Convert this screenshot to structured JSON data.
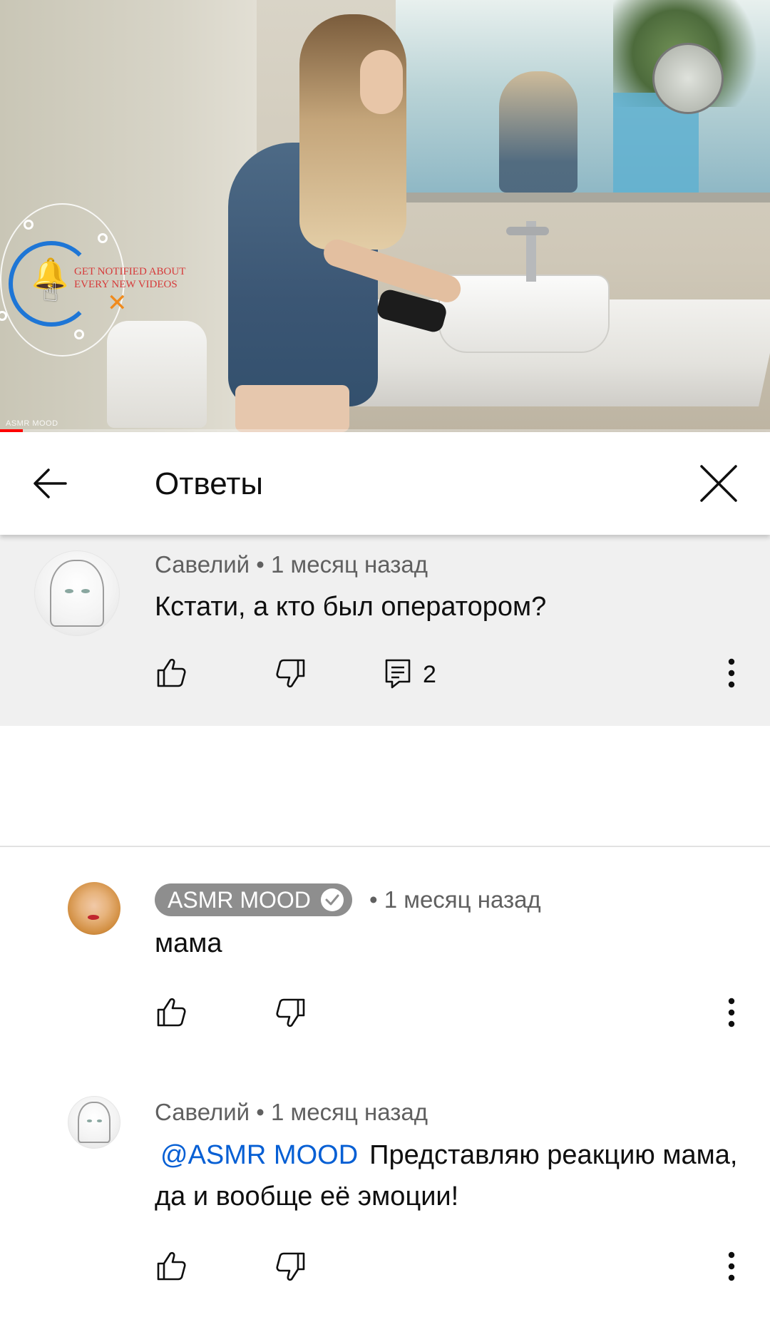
{
  "video": {
    "overlay_text": "GET NOTIFIED ABOUT EVERY NEW VIDEOS",
    "watermark": "ASMR MOOD",
    "progress": 0.03
  },
  "header": {
    "title": "Ответы"
  },
  "parent_comment": {
    "author": "Савелий",
    "time": "1 месяц назад",
    "text": "Кстати, а кто был оператором?",
    "reply_count": "2"
  },
  "replies": [
    {
      "author": "ASMR MOOD",
      "author_verified": true,
      "time": "1 месяц назад",
      "text": "мама"
    },
    {
      "author": "Савелий",
      "time": "1 месяц назад",
      "mention": "@ASMR MOOD",
      "text": "Представляю реакцию мама, да и вообще её эмоции!"
    }
  ],
  "separator": "•",
  "colors": {
    "mention": "#065fd4",
    "progress": "#ff0000",
    "meta": "#606060",
    "parent_bg": "#f0f0f0"
  },
  "icons": [
    "back-arrow-icon",
    "close-icon",
    "like-icon",
    "dislike-icon",
    "reply-icon",
    "more-vertical-icon",
    "verified-check-icon",
    "bell-icon"
  ]
}
